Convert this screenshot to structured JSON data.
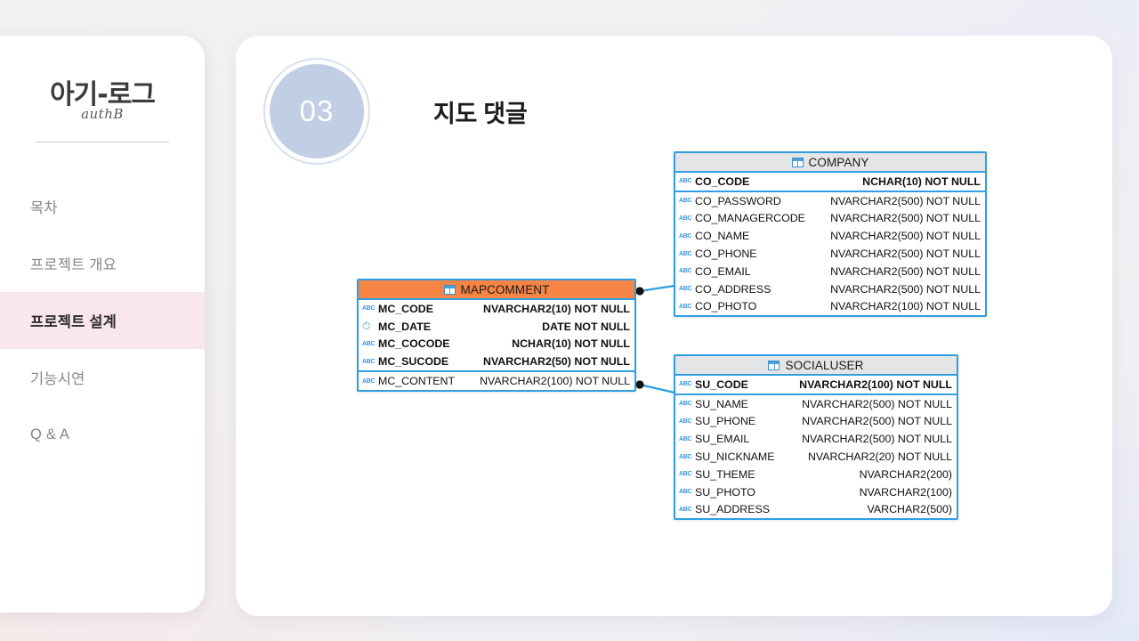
{
  "sidebar": {
    "brand": {
      "logo": "아기-로그",
      "sub": "authB"
    },
    "items": [
      {
        "label": "목차",
        "active": false
      },
      {
        "label": "프로젝트 개요",
        "active": false
      },
      {
        "label": "프로젝트 설계",
        "active": true
      },
      {
        "label": "기능시연",
        "active": false
      },
      {
        "label": "Q & A",
        "active": false
      }
    ]
  },
  "slide": {
    "step_number": "03",
    "title": "지도 댓글"
  },
  "colors": {
    "accent_pink": "#fae7ec",
    "badge_blue": "#c1cee4",
    "table_border": "#2f9fe0",
    "header_orange": "#f58445",
    "header_grey": "#e3e5e6"
  },
  "erd": {
    "tables": [
      {
        "name": "MAPCOMMENT",
        "header_style": "orange",
        "icon": "table-grid-icon",
        "primary_keys": [
          {
            "icon": "abc-icon",
            "column": "MC_CODE",
            "type": "NVARCHAR2(10) NOT NULL"
          },
          {
            "icon": "clock-icon",
            "column": "MC_DATE",
            "type": "DATE NOT NULL"
          },
          {
            "icon": "abc-icon",
            "column": "MC_COCODE",
            "type": "NCHAR(10) NOT NULL"
          },
          {
            "icon": "abc-icon",
            "column": "MC_SUCODE",
            "type": "NVARCHAR2(50) NOT NULL"
          }
        ],
        "columns": [
          {
            "icon": "abc-icon",
            "column": "MC_CONTENT",
            "type": "NVARCHAR2(100) NOT NULL"
          }
        ]
      },
      {
        "name": "COMPANY",
        "header_style": "grey",
        "icon": "table-grid-icon",
        "primary_keys": [
          {
            "icon": "abc-icon",
            "column": "CO_CODE",
            "type": "NCHAR(10) NOT NULL"
          }
        ],
        "columns": [
          {
            "icon": "abc-icon",
            "column": "CO_PASSWORD",
            "type": "NVARCHAR2(500) NOT NULL"
          },
          {
            "icon": "abc-icon",
            "column": "CO_MANAGERCODE",
            "type": "NVARCHAR2(500) NOT NULL"
          },
          {
            "icon": "abc-icon",
            "column": "CO_NAME",
            "type": "NVARCHAR2(500) NOT NULL"
          },
          {
            "icon": "abc-icon",
            "column": "CO_PHONE",
            "type": "NVARCHAR2(500) NOT NULL"
          },
          {
            "icon": "abc-icon",
            "column": "CO_EMAIL",
            "type": "NVARCHAR2(500) NOT NULL"
          },
          {
            "icon": "abc-icon",
            "column": "CO_ADDRESS",
            "type": "NVARCHAR2(500) NOT NULL"
          },
          {
            "icon": "abc-icon",
            "column": "CO_PHOTO",
            "type": "NVARCHAR2(100) NOT NULL"
          }
        ]
      },
      {
        "name": "SOCIALUSER",
        "header_style": "grey",
        "icon": "table-grid-icon",
        "primary_keys": [
          {
            "icon": "abc-icon",
            "column": "SU_CODE",
            "type": "NVARCHAR2(100) NOT NULL"
          }
        ],
        "columns": [
          {
            "icon": "abc-icon",
            "column": "SU_NAME",
            "type": "NVARCHAR2(500) NOT NULL"
          },
          {
            "icon": "abc-icon",
            "column": "SU_PHONE",
            "type": "NVARCHAR2(500) NOT NULL"
          },
          {
            "icon": "abc-icon",
            "column": "SU_EMAIL",
            "type": "NVARCHAR2(500) NOT NULL"
          },
          {
            "icon": "abc-icon",
            "column": "SU_NICKNAME",
            "type": "NVARCHAR2(20) NOT NULL"
          },
          {
            "icon": "abc-icon",
            "column": "SU_THEME",
            "type": "NVARCHAR2(200)"
          },
          {
            "icon": "abc-icon",
            "column": "SU_PHOTO",
            "type": "NVARCHAR2(100)"
          },
          {
            "icon": "abc-icon",
            "column": "SU_ADDRESS",
            "type": "VARCHAR2(500)"
          }
        ]
      }
    ],
    "relationships": [
      {
        "from": "MAPCOMMENT",
        "to": "COMPANY"
      },
      {
        "from": "MAPCOMMENT",
        "to": "SOCIALUSER"
      }
    ]
  }
}
